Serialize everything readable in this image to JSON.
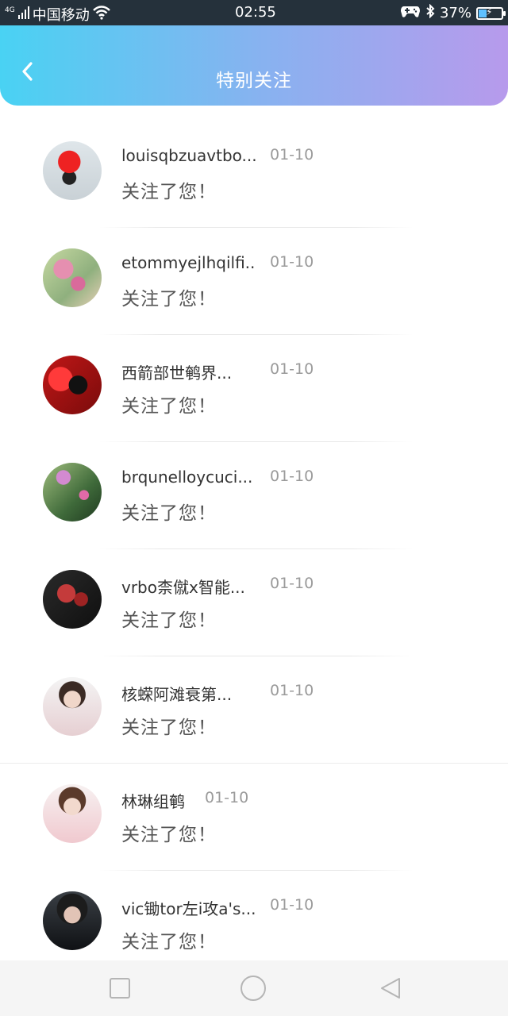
{
  "status_bar": {
    "network": "4G",
    "carrier": "中国移动",
    "time": "02:55",
    "battery": "37%",
    "battery_level": 0.37
  },
  "header": {
    "title": "特别关注"
  },
  "list": {
    "items": [
      {
        "name": "louisqbzuavtbo...",
        "date": "01-10",
        "message": "关注了您！"
      },
      {
        "name": "etommyejlhqilfi...",
        "date": "01-10",
        "message": "关注了您！"
      },
      {
        "name": "西箭部世鹌界...",
        "date": "01-10",
        "message": "关注了您！"
      },
      {
        "name": "brqunelloycuci...",
        "date": "01-10",
        "message": "关注了您！"
      },
      {
        "name": "vrbo柰僦x智能...",
        "date": "01-10",
        "message": "关注了您！"
      },
      {
        "name": "核蝾阿滩衰第...",
        "date": "01-10",
        "message": "关注了您！"
      },
      {
        "name": "林琳组鹌",
        "date": "01-10",
        "message": "关注了您！"
      },
      {
        "name": "vic锄tor左i攻a's...",
        "date": "01-10",
        "message": "关注了您！"
      }
    ]
  },
  "nav": {
    "icons": [
      "square-icon",
      "circle-icon",
      "triangle-back-icon"
    ]
  }
}
